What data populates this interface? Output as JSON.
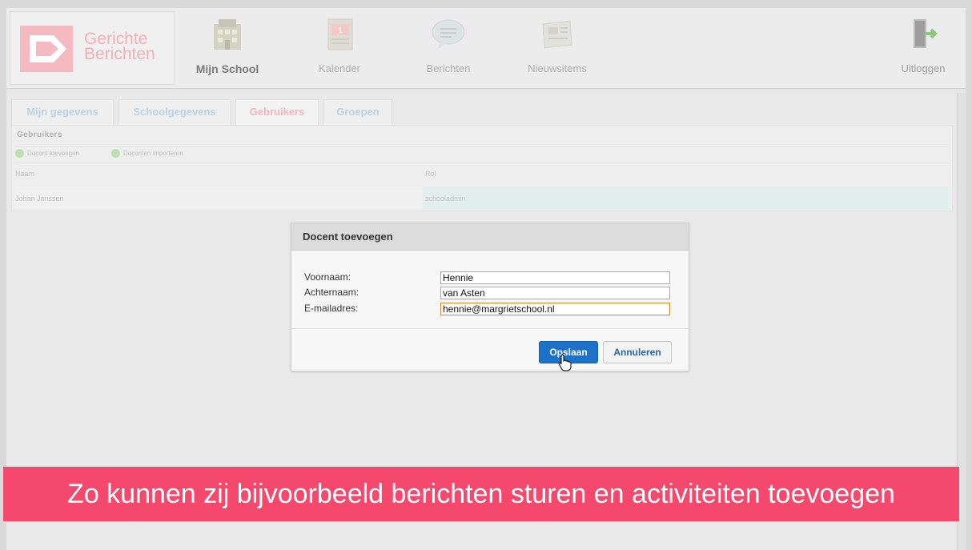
{
  "logo": {
    "line1": "Gerichte",
    "line2": "Berichten"
  },
  "nav": [
    {
      "label": "Mijn School",
      "icon": "school-building-icon"
    },
    {
      "label": "Kalender",
      "icon": "calendar-icon"
    },
    {
      "label": "Berichten",
      "icon": "speech-bubble-icon"
    },
    {
      "label": "Nieuwsitems",
      "icon": "newspaper-icon"
    }
  ],
  "logout": {
    "label": "Uitloggen",
    "icon": "door-exit-icon"
  },
  "tabs": [
    "Mijn gegevens",
    "Schoolgegevens",
    "Gebruikers",
    "Groepen"
  ],
  "active_tab": "Gebruikers",
  "panel": {
    "title": "Gebruikers",
    "buttons": [
      "Docent toevoegen",
      "Docenten importeren"
    ],
    "columns": [
      "Naam",
      "Rol"
    ],
    "rows": [
      {
        "naam": "Johan Janssen",
        "rol": "schooladmin"
      }
    ]
  },
  "dialog": {
    "title": "Docent toevoegen",
    "fields": [
      {
        "label": "Voornaam:",
        "value": "Hennie"
      },
      {
        "label": "Achternaam:",
        "value": "van Asten"
      },
      {
        "label": "E-mailadres:",
        "value": "hennie@margrietschool.nl"
      }
    ],
    "save_label": "Opslaan",
    "cancel_label": "Annuleren"
  },
  "caption": "Zo kunnen zij bijvoorbeeld berichten sturen en activiteiten toevoegen",
  "colors": {
    "caption_bg": "#f4496c",
    "primary_button": "#1c72c9",
    "logo": "#f0b0b8",
    "tab_active": "#f2b5c0",
    "tab_inactive": "#b8d3e6"
  }
}
